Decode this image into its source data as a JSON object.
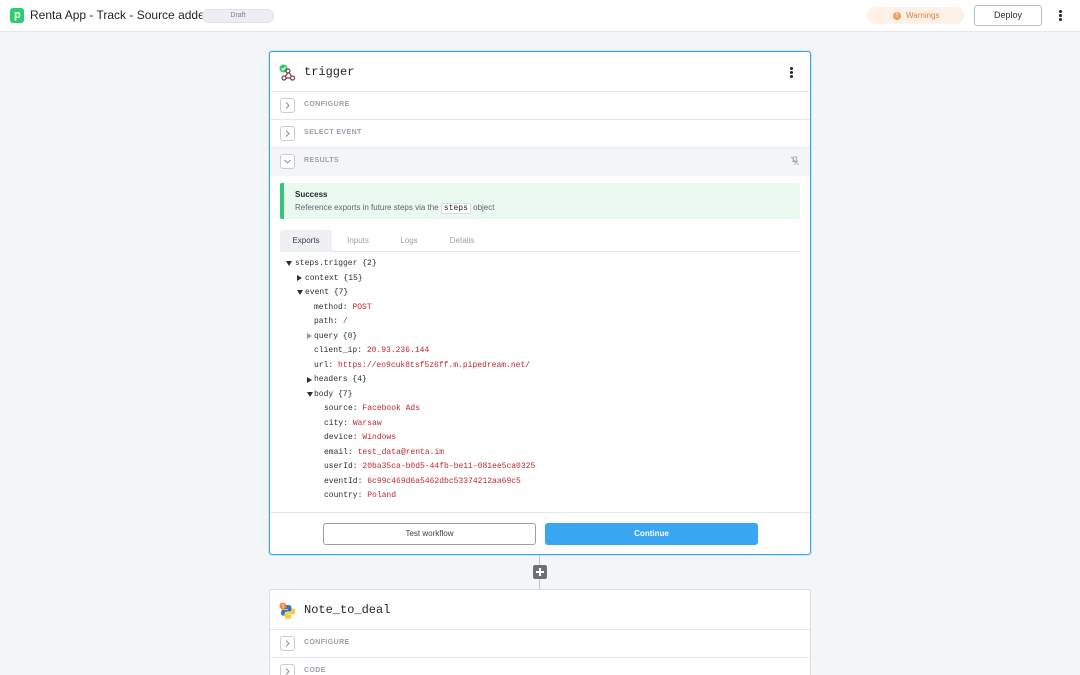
{
  "header": {
    "logo_letter": "p",
    "title": "Renta App - Track - Source added",
    "badge": "Draft",
    "warnings_label": "Warnings",
    "deploy_label": "Deploy"
  },
  "trigger_step": {
    "title": "trigger",
    "sections": {
      "configure": "CONFIGURE",
      "select_event": "SELECT EVENT",
      "results": "RESULTS"
    },
    "success": {
      "title": "Success",
      "message_before": "Reference exports in future steps via the",
      "code": "steps",
      "message_after": "object"
    },
    "tabs": [
      "Exports",
      "Inputs",
      "Logs",
      "Details"
    ],
    "tree": {
      "root": "steps.trigger {2}",
      "context": "context {15}",
      "event": "event {7}",
      "method_key": "method:",
      "method_val": "POST",
      "path_key": "path:",
      "path_val": "/",
      "query": "query {0}",
      "client_ip_key": "client_ip:",
      "client_ip_val": "20.93.236.144",
      "url_key": "url:",
      "url_val": "https://eo9cuk8tsf5z6ff.m.pipedream.net/",
      "headers": "headers {4}",
      "body": "body {7}",
      "source_key": "source:",
      "source_val": "Facebook Ads",
      "city_key": "city:",
      "city_val": "Warsaw",
      "device_key": "device:",
      "device_val": "Windows",
      "email_key": "email:",
      "email_val": "test_data@renta.im",
      "userId_key": "userId:",
      "userId_val": "20ba35ca-b0d5-44fb-be11-081ee5ca0325",
      "eventId_key": "eventId:",
      "eventId_val": "6c99c469d6a5462dbc53374212aa69c5",
      "country_key": "country:",
      "country_val": "Poland"
    },
    "buttons": {
      "test": "Test workflow",
      "continue": "Continue"
    }
  },
  "note_step": {
    "title": "Note_to_deal",
    "sections": {
      "configure": "CONFIGURE",
      "code": "CODE"
    }
  },
  "colors": {
    "accent": "#38a6f0",
    "success": "#35c47a",
    "value": "#c0282e",
    "warning": "#e0813a"
  }
}
